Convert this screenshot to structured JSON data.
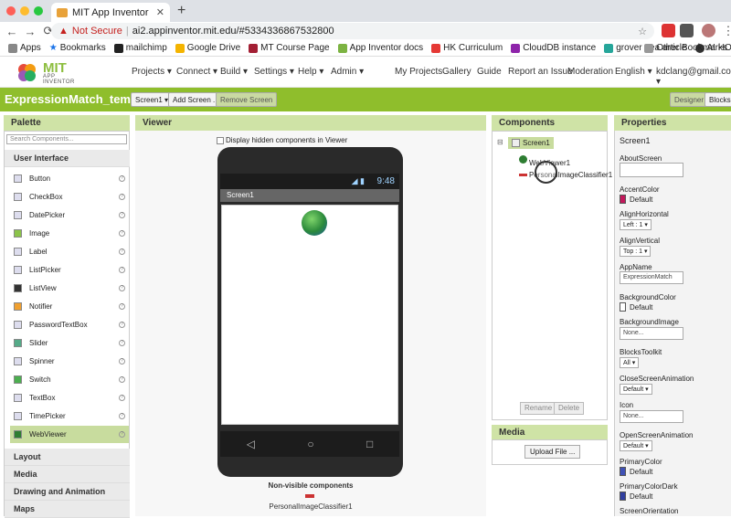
{
  "browser": {
    "tab_title": "MIT App Inventor",
    "security_label": "Not Secure",
    "url": "ai2.appinventor.mit.edu/#5334336867532800",
    "bookmarks": [
      "Apps",
      "Bookmarks",
      "mailchimp",
      "Google Drive",
      "MT Course Page",
      "App Inventor docs",
      "HK Curriculum",
      "CloudDB instance",
      "grover pea article",
      "AI HOC"
    ],
    "other_bookmarks": "Other Bookmarks"
  },
  "logo": {
    "mit": "MIT",
    "sub": "APP INVENTOR"
  },
  "top_menu": {
    "left": [
      "Projects ▾",
      "Connect ▾",
      "Build ▾",
      "Settings ▾",
      "Help ▾",
      "Admin ▾"
    ],
    "right": [
      "My Projects",
      "Gallery",
      "Guide",
      "Report an Issue",
      "Moderation",
      "English ▾",
      "kdclang@gmail.com ▾"
    ]
  },
  "toolbar": {
    "project_name": "ExpressionMatch_template",
    "screen_select": "Screen1 ▾",
    "add_screen": "Add Screen ...",
    "remove_screen": "Remove Screen",
    "designer": "Designer",
    "blocks": "Blocks"
  },
  "palette": {
    "title": "Palette",
    "search_placeholder": "Search Components...",
    "category_ui": "User Interface",
    "items": [
      "Button",
      "CheckBox",
      "DatePicker",
      "Image",
      "Label",
      "ListPicker",
      "ListView",
      "Notifier",
      "PasswordTextBox",
      "Slider",
      "Spinner",
      "Switch",
      "TextBox",
      "TimePicker",
      "WebViewer"
    ],
    "categories_below": [
      "Layout",
      "Media",
      "Drawing and Animation",
      "Maps"
    ]
  },
  "viewer": {
    "title": "Viewer",
    "hidden_checkbox": "Display hidden components in Viewer",
    "time": "9:48",
    "screen_title": "Screen1",
    "nonvisible_heading": "Non-visible components",
    "nonvisible_item": "PersonalImageClassifier1"
  },
  "components": {
    "title": "Components",
    "screen": "Screen1",
    "children": [
      "WebViewer1",
      "PersonalImageClassifier1"
    ],
    "rename": "Rename",
    "delete": "Delete"
  },
  "media": {
    "title": "Media",
    "upload": "Upload File ..."
  },
  "properties": {
    "title": "Properties",
    "component": "Screen1",
    "about_screen": "AboutScreen",
    "accent_color": "AccentColor",
    "accent_value": "Default",
    "align_h": "AlignHorizontal",
    "align_h_value": "Left : 1 ▾",
    "align_v": "AlignVertical",
    "align_v_value": "Top : 1 ▾",
    "app_name": "AppName",
    "app_name_value": "ExpressionMatch",
    "bg_color": "BackgroundColor",
    "bg_color_value": "Default",
    "bg_image": "BackgroundImage",
    "bg_image_value": "None...",
    "blocks_toolkit": "BlocksToolkit",
    "blocks_toolkit_value": "All ▾",
    "close_anim": "CloseScreenAnimation",
    "close_anim_value": "Default ▾",
    "icon": "Icon",
    "icon_value": "None...",
    "open_anim": "OpenScreenAnimation",
    "open_anim_value": "Default ▾",
    "primary_color": "PrimaryColor",
    "primary_color_value": "Default",
    "primary_dark": "PrimaryColorDark",
    "primary_dark_value": "Default",
    "screen_orientation": "ScreenOrientation"
  },
  "colors": {
    "accent": "#8fbe2c",
    "accent_swatch": "#c2185b",
    "primary_swatch": "#3f51b5",
    "primary_dark_swatch": "#303f9f"
  }
}
